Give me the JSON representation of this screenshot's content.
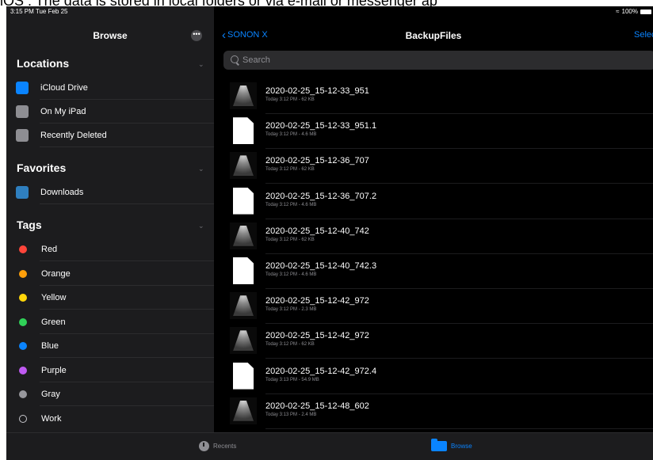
{
  "caption": "iOS : The data is stored in local folders or via e-mail or messenger ap",
  "status": {
    "time": "3:15 PM  Tue Feb 25",
    "battery": "100%"
  },
  "sidebar": {
    "title": "Browse",
    "more_icon": "ellipsis-icon",
    "locations": {
      "header": "Locations",
      "items": [
        {
          "label": "iCloud Drive",
          "icon": "icloud-icon",
          "color": "#0a84ff"
        },
        {
          "label": "On My iPad",
          "icon": "ipad-icon",
          "color": "#8e8e93"
        },
        {
          "label": "Recently Deleted",
          "icon": "trash-icon",
          "color": "#8e8e93"
        }
      ]
    },
    "favorites": {
      "header": "Favorites",
      "items": [
        {
          "label": "Downloads",
          "icon": "downloads-folder-icon",
          "color": "#2f7fbf"
        }
      ]
    },
    "tags": {
      "header": "Tags",
      "items": [
        {
          "label": "Red",
          "color": "#ff453a"
        },
        {
          "label": "Orange",
          "color": "#ff9f0a"
        },
        {
          "label": "Yellow",
          "color": "#ffd60a"
        },
        {
          "label": "Green",
          "color": "#30d158"
        },
        {
          "label": "Blue",
          "color": "#0a84ff"
        },
        {
          "label": "Purple",
          "color": "#bf5af2"
        },
        {
          "label": "Gray",
          "color": "#98989d"
        },
        {
          "label": "Work",
          "color": "outline"
        }
      ]
    }
  },
  "main": {
    "back_label": "SONON X",
    "title": "BackupFiles",
    "select_label": "Select",
    "search_placeholder": "Search",
    "files": [
      {
        "name": "2020-02-25_15-12-33_951",
        "meta": "Today 3:12 PM - 62 KB",
        "thumb": "ultrasound"
      },
      {
        "name": "2020-02-25_15-12-33_951.1",
        "meta": "Today 3:12 PM - 4.6 MB",
        "thumb": "document"
      },
      {
        "name": "2020-02-25_15-12-36_707",
        "meta": "Today 3:12 PM - 62 KB",
        "thumb": "ultrasound"
      },
      {
        "name": "2020-02-25_15-12-36_707.2",
        "meta": "Today 3:12 PM - 4.6 MB",
        "thumb": "document"
      },
      {
        "name": "2020-02-25_15-12-40_742",
        "meta": "Today 3:12 PM - 62 KB",
        "thumb": "ultrasound"
      },
      {
        "name": "2020-02-25_15-12-40_742.3",
        "meta": "Today 3:12 PM - 4.6 MB",
        "thumb": "document"
      },
      {
        "name": "2020-02-25_15-12-42_972",
        "meta": "Today 3:12 PM - 2.3 MB",
        "thumb": "ultrasound"
      },
      {
        "name": "2020-02-25_15-12-42_972",
        "meta": "Today 3:12 PM - 62 KB",
        "thumb": "ultrasound"
      },
      {
        "name": "2020-02-25_15-12-42_972.4",
        "meta": "Today 3:13 PM - 54.9 MB",
        "thumb": "document"
      },
      {
        "name": "2020-02-25_15-12-48_602",
        "meta": "Today 3:13 PM - 2.4 MB",
        "thumb": "ultrasound"
      }
    ]
  },
  "tabbar": {
    "recents_label": "Recents",
    "browse_label": "Browse",
    "active_color": "#0a84ff",
    "inactive_color": "#8e8e93"
  }
}
